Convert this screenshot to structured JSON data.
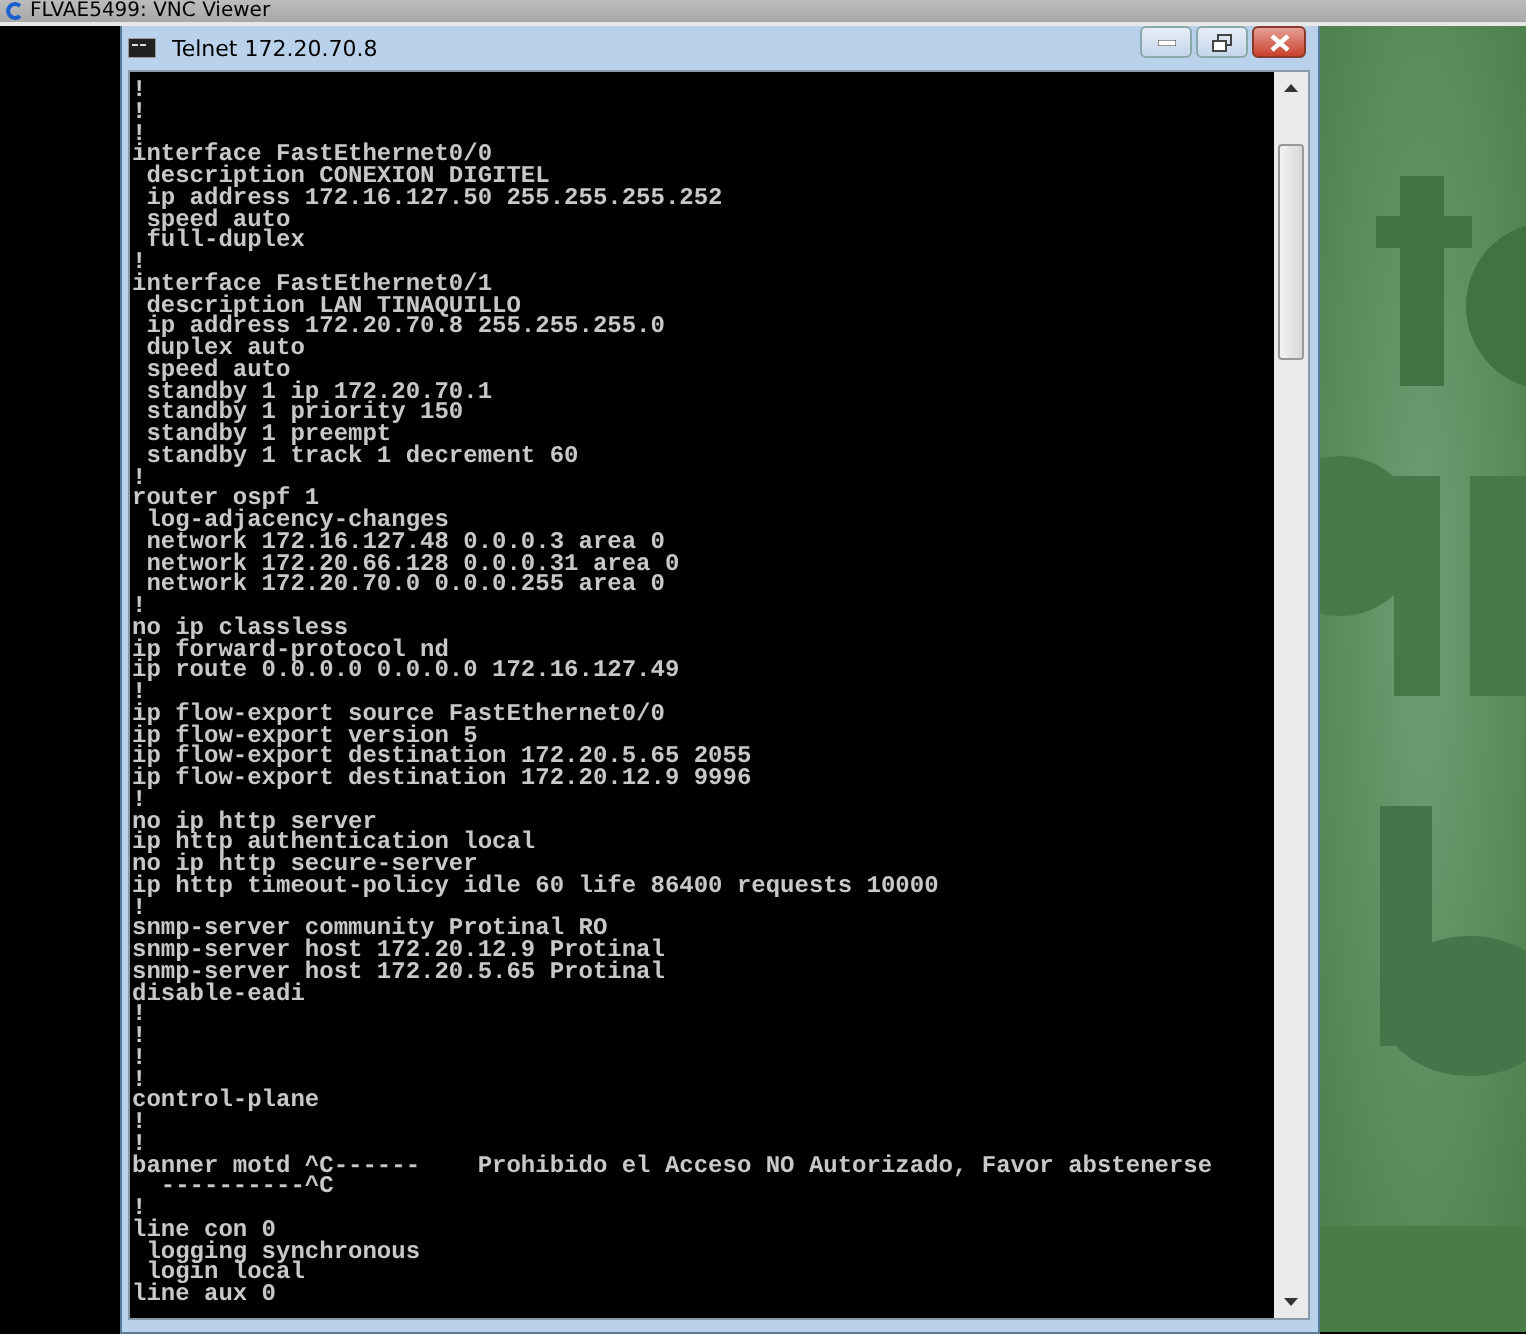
{
  "viewer": {
    "title": "FLVAE5499: VNC Viewer"
  },
  "window": {
    "title": "Telnet 172.20.70.8"
  },
  "console": {
    "lines": [
      "!",
      "!",
      "!",
      "interface FastEthernet0/0",
      " description CONEXION DIGITEL",
      " ip address 172.16.127.50 255.255.255.252",
      " speed auto",
      " full-duplex",
      "!",
      "interface FastEthernet0/1",
      " description LAN TINAQUILLO",
      " ip address 172.20.70.8 255.255.255.0",
      " duplex auto",
      " speed auto",
      " standby 1 ip 172.20.70.1",
      " standby 1 priority 150",
      " standby 1 preempt",
      " standby 1 track 1 decrement 60",
      "!",
      "router ospf 1",
      " log-adjacency-changes",
      " network 172.16.127.48 0.0.0.3 area 0",
      " network 172.20.66.128 0.0.0.31 area 0",
      " network 172.20.70.0 0.0.0.255 area 0",
      "!",
      "no ip classless",
      "ip forward-protocol nd",
      "ip route 0.0.0.0 0.0.0.0 172.16.127.49",
      "!",
      "ip flow-export source FastEthernet0/0",
      "ip flow-export version 5",
      "ip flow-export destination 172.20.5.65 2055",
      "ip flow-export destination 172.20.12.9 9996",
      "!",
      "no ip http server",
      "ip http authentication local",
      "no ip http secure-server",
      "ip http timeout-policy idle 60 life 86400 requests 10000",
      "!",
      "snmp-server community Protinal RO",
      "snmp-server host 172.20.12.9 Protinal",
      "snmp-server host 172.20.5.65 Protinal",
      "disable-eadi",
      "!",
      "!",
      "!",
      "!",
      "control-plane",
      "!",
      "!",
      "banner motd ^C------    Prohibido el Acceso NO Autorizado, Favor abstenerse",
      "  ----------^C",
      "!",
      "line con 0",
      " logging synchronous",
      " login local",
      "line aux 0"
    ]
  }
}
